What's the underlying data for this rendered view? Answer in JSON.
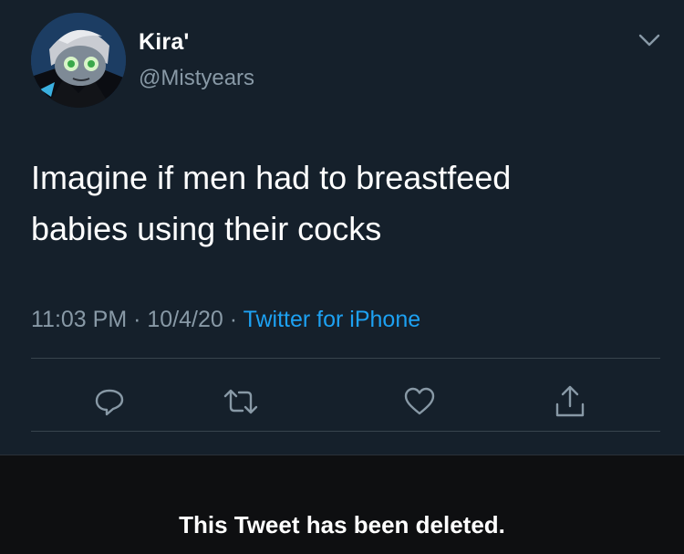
{
  "tweet": {
    "display_name": "Kira'",
    "handle": "@Mistyears",
    "text_line1": "Imagine if men had to breastfeed",
    "text_line2": "babies using their cocks",
    "time": "11:03 PM",
    "separator": "·",
    "date": "10/4/20",
    "source": "Twitter for iPhone",
    "actions": [
      "reply-icon",
      "retweet-icon",
      "like-icon",
      "share-icon"
    ],
    "menu_icon": "chevron-down-icon"
  },
  "notice": {
    "text": "This Tweet has been deleted."
  },
  "colors": {
    "background": "#15202b",
    "secondary_text": "#8899a6",
    "link": "#1da1f2",
    "divider": "#38444d",
    "notice_background": "#0e0f11"
  }
}
